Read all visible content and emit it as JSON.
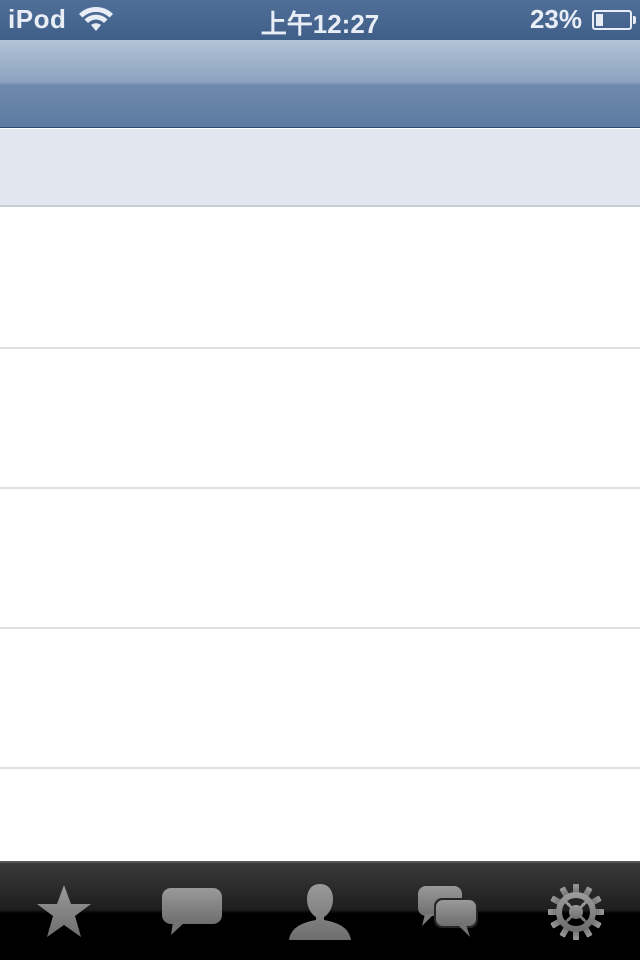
{
  "status_bar": {
    "carrier": "iPod",
    "time": "上午12:27",
    "battery_percent": "23%",
    "battery_level": 0.23
  },
  "nav_bar": {
    "title": ""
  },
  "list": {
    "row_count": 5
  },
  "tab_bar": {
    "tabs": [
      {
        "icon": "star-icon"
      },
      {
        "icon": "speech-bubble-icon"
      },
      {
        "icon": "person-icon"
      },
      {
        "icon": "chat-bubbles-icon"
      },
      {
        "icon": "gear-icon"
      }
    ]
  },
  "colors": {
    "status_bar": "#4f6f98",
    "nav_bar_top": "#b3c3d7",
    "nav_bar_bottom": "#5d7aa1",
    "sub_header": "#e2e7ef",
    "tab_bar": "#000000",
    "tab_icon": "#8a8a8a"
  }
}
